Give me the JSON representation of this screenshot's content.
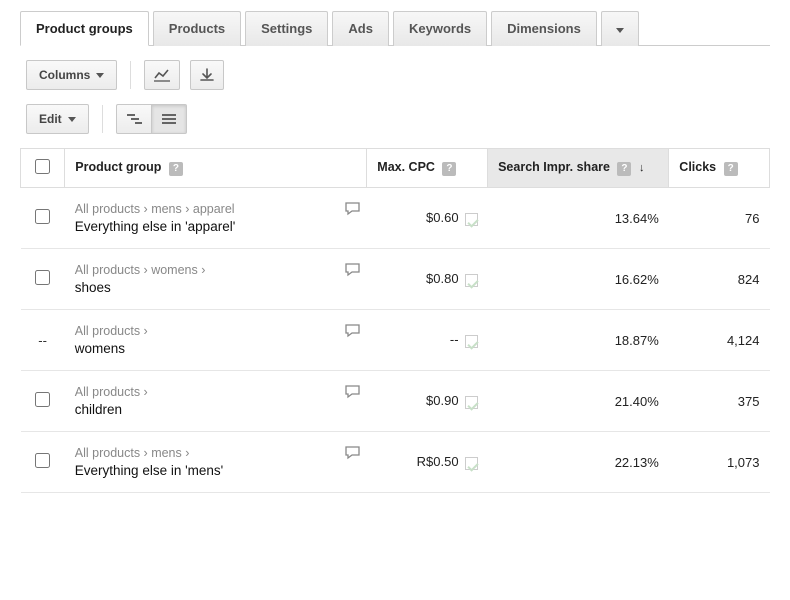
{
  "tabs": [
    "Product groups",
    "Products",
    "Settings",
    "Ads",
    "Keywords",
    "Dimensions"
  ],
  "toolbar": {
    "columns_label": "Columns",
    "edit_label": "Edit"
  },
  "columns": {
    "product_group": "Product group",
    "max_cpc": "Max. CPC",
    "search_impr_share": "Search Impr. share",
    "clicks": "Clicks"
  },
  "rows": [
    {
      "breadcrumb": "All products › mens › apparel",
      "name": "Everything else in 'apparel'",
      "cpc": "$0.60",
      "sis": "13.64%",
      "clicks": "76",
      "checkbox": true
    },
    {
      "breadcrumb": "All products › womens ›",
      "name": "shoes",
      "cpc": "$0.80",
      "sis": "16.62%",
      "clicks": "824",
      "checkbox": true
    },
    {
      "breadcrumb": "All products ›",
      "name": "womens",
      "cpc": "--",
      "sis": "18.87%",
      "clicks": "4,124",
      "checkbox": false,
      "cb_text": "--"
    },
    {
      "breadcrumb": "All products ›",
      "name": "children",
      "cpc": "$0.90",
      "sis": "21.40%",
      "clicks": "375",
      "checkbox": true
    },
    {
      "breadcrumb": "All products › mens ›",
      "name": "Everything else in 'mens'",
      "cpc": "R$0.50",
      "sis": "22.13%",
      "clicks": "1,073",
      "checkbox": true
    }
  ]
}
